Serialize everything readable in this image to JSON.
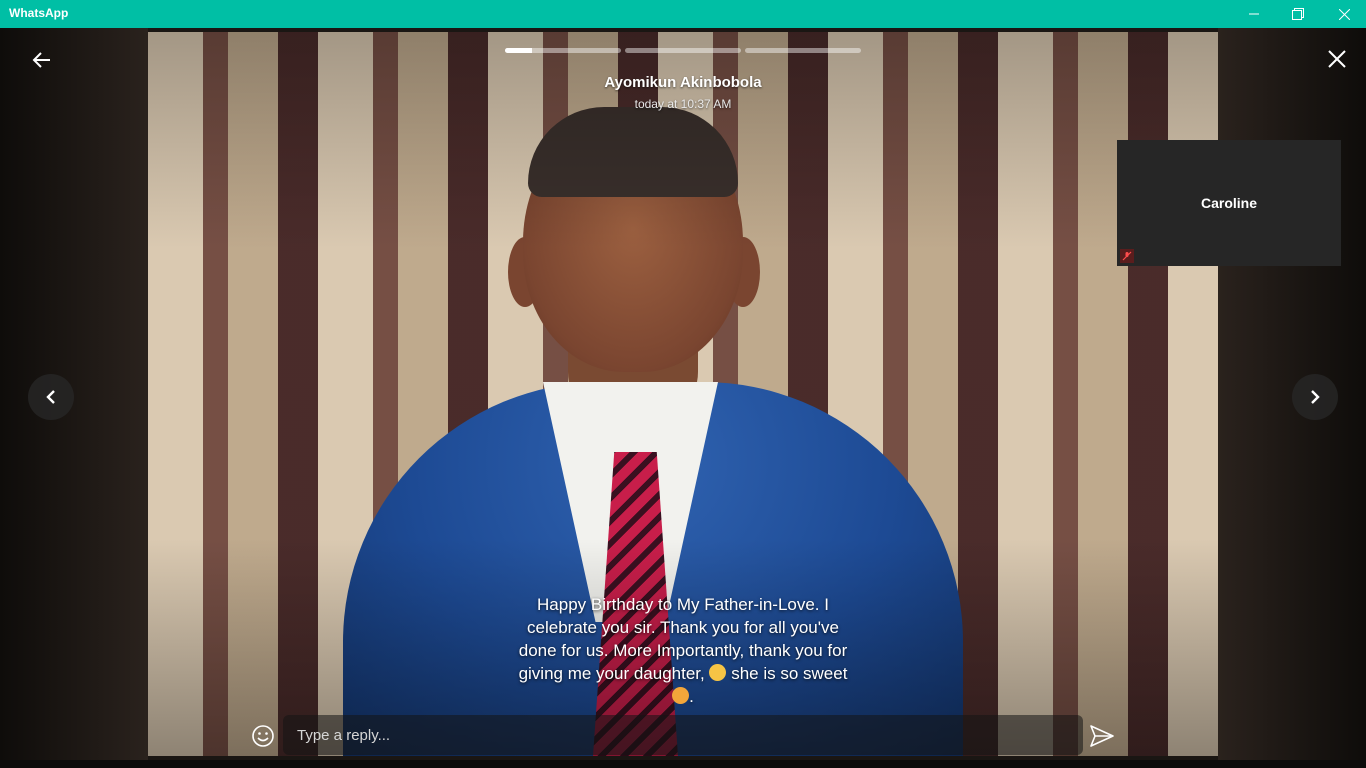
{
  "window": {
    "title": "WhatsApp"
  },
  "status": {
    "progress_fills": [
      0.23,
      0,
      0
    ],
    "sender": "Ayomikun Akinbobola",
    "time": "today at 10:37 AM",
    "caption_line1": "Happy Birthday to My Father-in-Love. I",
    "caption_line2": "celebrate you sir. Thank you for all you've",
    "caption_line3": "done for us. More Importantly, thank you for",
    "caption_line4a": "giving me your daughter,",
    "caption_line4b": "she is so sweet",
    "caption_line5": "."
  },
  "call": {
    "name": "Caroline"
  },
  "reply": {
    "placeholder": "Type a reply..."
  },
  "icons": {
    "back": "arrow-left-icon",
    "close": "close-icon",
    "prev": "chevron-left-icon",
    "next": "chevron-right-icon",
    "emoji": "smiley-icon",
    "send": "send-icon",
    "mic_muted": "mic-off-icon"
  },
  "colors": {
    "titlebar": "#00bfa5"
  }
}
